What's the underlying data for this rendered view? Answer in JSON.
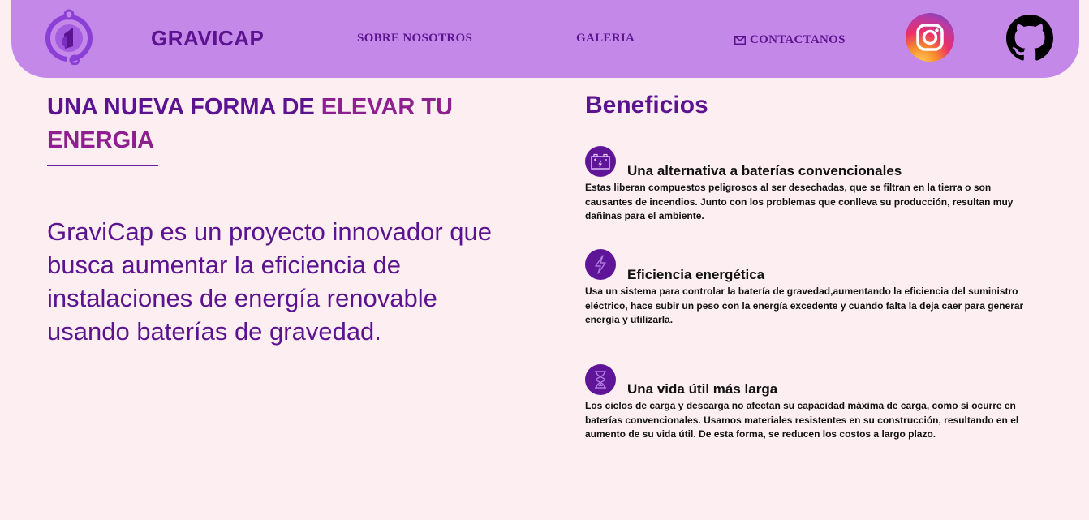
{
  "nav": {
    "brand": "GRAVICAP",
    "links": {
      "about": "SOBRE NOSOTROS",
      "gallery": "GALERIA",
      "contact": "CONTACTANOS"
    },
    "logo_icon": "gravicap-logo-icon",
    "social": [
      "instagram-icon",
      "github-icon"
    ]
  },
  "hero": {
    "title_part1": "UNA NUEVA FORMA DE ",
    "title_part2": "ELEVAR TU ENERGIA",
    "description": "GraviCap es un proyecto innovador que busca aumentar la eficiencia de instalaciones de energía renovable usando baterías de gravedad."
  },
  "benefits": {
    "title": "Beneficios",
    "items": [
      {
        "icon": "battery-icon",
        "title": "Una alternativa a baterías convencionales",
        "text": "Estas liberan compuestos peligrosos al ser desechadas, que se filtran en la tierra o son causantes de incendios. Junto con los problemas que conlleva su producción, resultan muy dañinas para el ambiente."
      },
      {
        "icon": "lightning-icon",
        "title": "Eficiencia energética",
        "text": "Usa un sistema para controlar la batería de gravedad,aumentando la eficiencia del suministro eléctrico, hace subir un peso con la energía excedente y cuando falta la deja caer para generar energía y utilizarla."
      },
      {
        "icon": "hourglass-icon",
        "title": "Una vida útil más larga",
        "text": "Los ciclos de carga y descarga no afectan su capacidad máxima de carga, como sí ocurre en baterías convencionales. Usamos materiales resistentes en su construcción, resultando en el aumento de su vida útil. De esta forma, se reducen los costos a largo plazo."
      }
    ]
  },
  "colors": {
    "nav_bg": "#c489e8",
    "page_bg": "#fdeef2",
    "primary": "#5c138f",
    "accent": "#8e1f8e"
  }
}
